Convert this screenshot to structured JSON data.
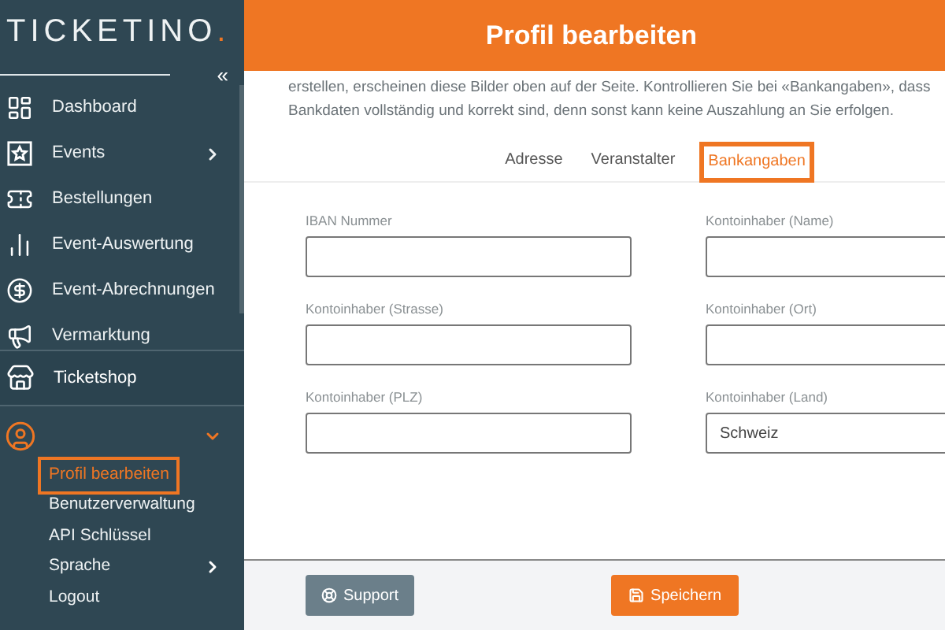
{
  "sidebar": {
    "logo": {
      "name": "TICKETINO",
      "mark": "."
    },
    "collapse": "«",
    "menu": [
      {
        "label": "Dashboard",
        "has_submenu": false
      },
      {
        "label": "Events",
        "has_submenu": true
      },
      {
        "label": "Bestellungen",
        "has_submenu": false
      },
      {
        "label": "Event-Auswertung",
        "has_submenu": false
      },
      {
        "label": "Event-Abrechnungen",
        "has_submenu": false
      },
      {
        "label": "Vermarktung",
        "has_submenu": false
      }
    ],
    "shop": {
      "label": "Ticketshop"
    },
    "user": {
      "expanded": true,
      "items": [
        {
          "label": "Profil bearbeiten",
          "selected": true,
          "has_submenu": false
        },
        {
          "label": "Benutzerverwaltung",
          "selected": false,
          "has_submenu": false
        },
        {
          "label": "API Schlüssel",
          "selected": false,
          "has_submenu": false
        },
        {
          "label": "Sprache",
          "selected": false,
          "has_submenu": true
        },
        {
          "label": "Logout",
          "selected": false,
          "has_submenu": false
        }
      ]
    }
  },
  "header": {
    "title": "Profil bearbeiten"
  },
  "intro": [
    "erstellen, erscheinen diese Bilder oben auf der Seite. Kontrollieren Sie bei «Bankangaben», dass",
    "Bankdaten vollständig und korrekt sind, denn sonst kann keine Auszahlung an Sie erfolgen."
  ],
  "tabs": [
    {
      "label": "Adresse",
      "selected": false
    },
    {
      "label": "Veranstalter",
      "selected": false
    },
    {
      "label": "Bankangaben",
      "selected": true
    }
  ],
  "fields": [
    {
      "label": "IBAN Nummer"
    },
    {
      "label": "Kontoinhaber (Name)"
    },
    {
      "label": "Kontoinhaber (Strasse)"
    },
    {
      "label": "Kontoinhaber (Ort)"
    },
    {
      "label": "Kontoinhaber (PLZ)"
    },
    {
      "label": "Kontoinhaber (Land)",
      "value": "Schweiz"
    }
  ],
  "buttons": [
    {
      "label": "Support",
      "kind": "secondary"
    },
    {
      "label": "Speichern",
      "kind": "primary"
    }
  ]
}
